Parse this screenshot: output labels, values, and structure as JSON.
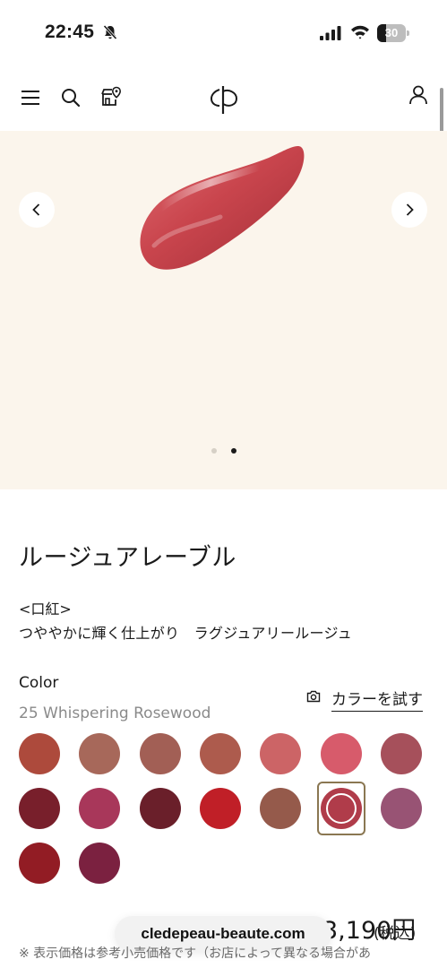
{
  "status_bar": {
    "time": "22:45",
    "battery": "30",
    "battery_level": 0.3
  },
  "header": {
    "menu_icon": "hamburger-icon",
    "search_icon": "search-icon",
    "store_icon": "store-locator-icon",
    "logo_icon": "cle-de-peau-logo-icon",
    "account_icon": "account-icon"
  },
  "hero": {
    "background": "#fbf5ec",
    "swatch_color": "#c9454d",
    "prev_icon": "chevron-left-icon",
    "next_icon": "chevron-right-icon",
    "carousel": {
      "count": 2,
      "active": 2
    }
  },
  "product": {
    "name": "ルージュアレーブル",
    "category": "<口紅>",
    "description": "つややかに輝く仕上がり　ラグジュアリールージュ",
    "color_label": "Color",
    "color_name": "25 Whispering Rosewood",
    "try_label": "カラーを試す",
    "try_icon": "camera-icon"
  },
  "shades": {
    "selected_index": 12,
    "colors": [
      "#ad4a3c",
      "#a7685a",
      "#a25f55",
      "#ad5b4d",
      "#cc6466",
      "#d75b6b",
      "#a6505b",
      "#781f2b",
      "#a8375a",
      "#6a1f2a",
      "#c01f27",
      "#955a4b",
      "#b03c4a",
      "#985374",
      "#921c24",
      "#7b2140"
    ]
  },
  "price": {
    "amount": "3,190円",
    "tax": "(税込)"
  },
  "browser": {
    "url": "cledepeau-beaute.com"
  },
  "footer": {
    "note": "※ 表示価格は参考小売価格です（お店によって異なる場合があ"
  }
}
